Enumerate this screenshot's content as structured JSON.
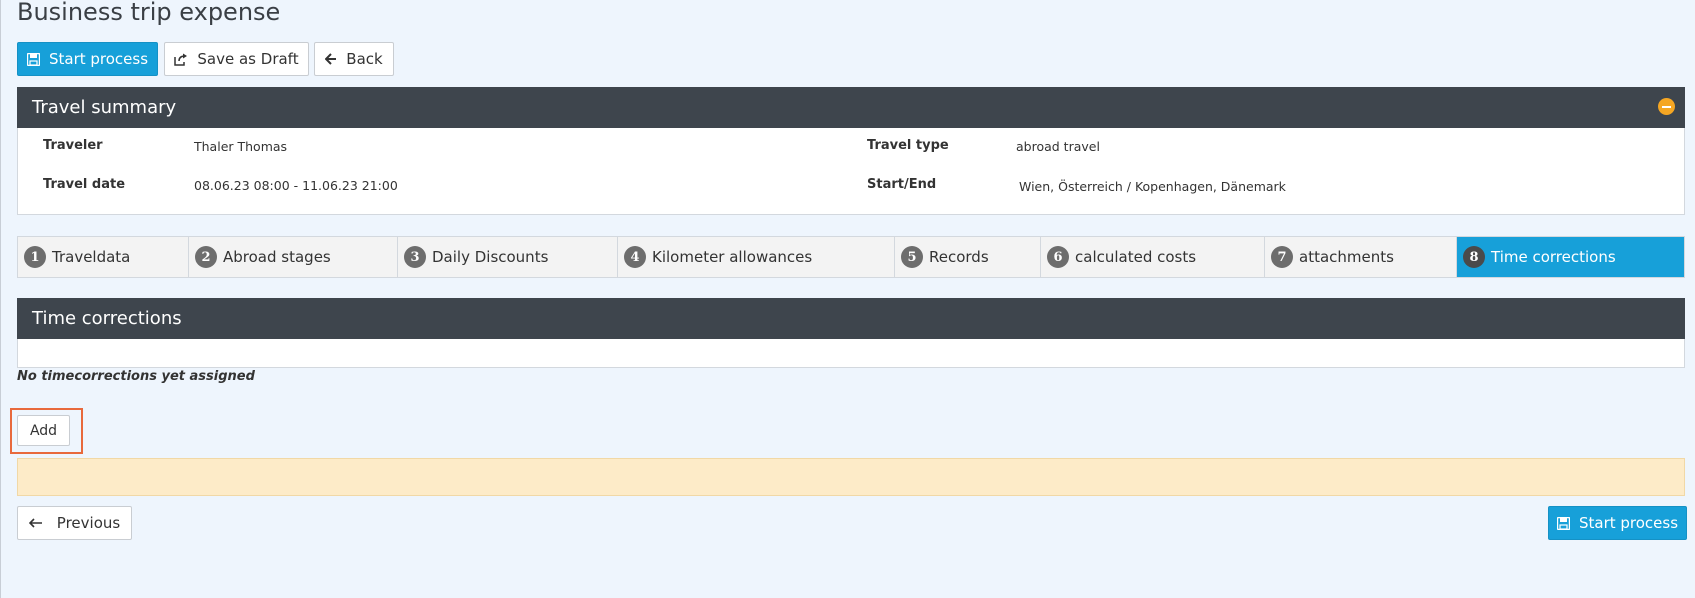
{
  "page": {
    "title": "Business trip expense"
  },
  "toolbar": {
    "start_process": "Start process",
    "save_draft": "Save as Draft",
    "back": "Back"
  },
  "summary": {
    "title": "Travel summary",
    "traveler_label": "Traveler",
    "traveler_value": "Thaler Thomas",
    "travel_date_label": "Travel date",
    "travel_date_value": "08.06.23 08:00 - 11.06.23 21:00",
    "travel_type_label": "Travel type",
    "travel_type_value": "abroad travel",
    "start_end_label": "Start/End",
    "start_end_value": "Wien, Österreich / Kopenhagen, Dänemark"
  },
  "tabs": [
    {
      "num": "1",
      "label": "Traveldata"
    },
    {
      "num": "2",
      "label": "Abroad stages"
    },
    {
      "num": "3",
      "label": "Daily Discounts"
    },
    {
      "num": "4",
      "label": "Kilometer allowances"
    },
    {
      "num": "5",
      "label": "Records"
    },
    {
      "num": "6",
      "label": "calculated costs"
    },
    {
      "num": "7",
      "label": "attachments"
    },
    {
      "num": "8",
      "label": "Time corrections",
      "active": true
    }
  ],
  "time_corrections": {
    "title": "Time corrections",
    "empty_message": "No timecorrections yet assigned",
    "add_button": "Add"
  },
  "footer": {
    "previous": "Previous",
    "start_process": "Start process"
  },
  "colors": {
    "primary": "#17a0d9",
    "panel_header": "#3e454d",
    "warning_bg": "#fdebc8",
    "highlight": "#e8693c"
  }
}
